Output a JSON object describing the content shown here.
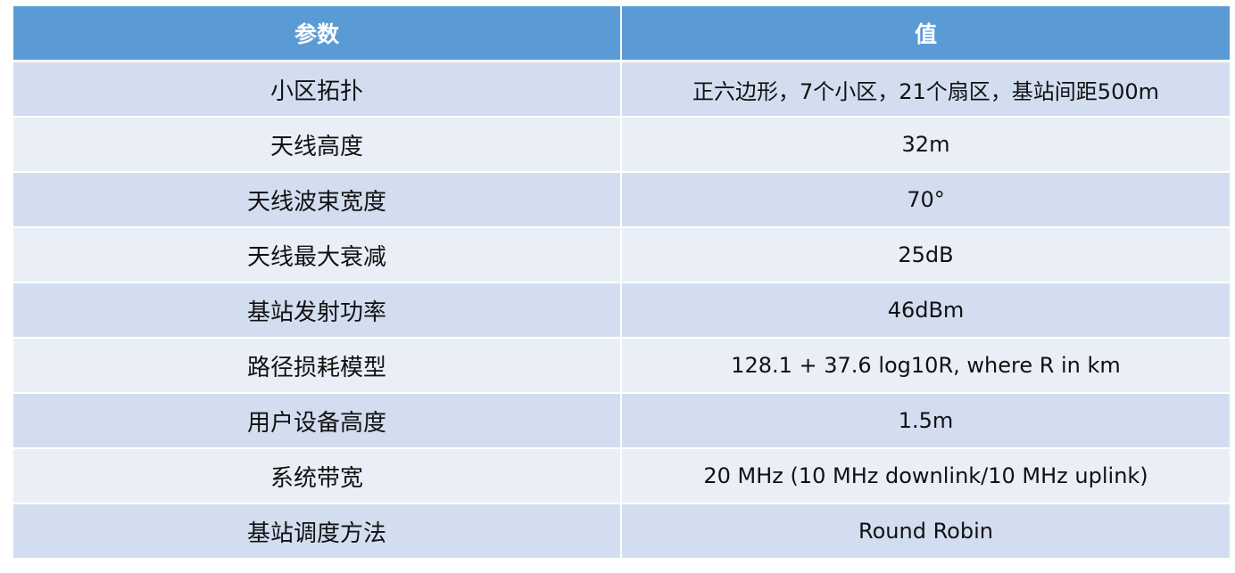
{
  "table": {
    "headers": [
      "参数",
      "值"
    ],
    "rows": [
      {
        "param": "小区拓扑",
        "value": "正六边形，7个小区，21个扇区，基站间距500m"
      },
      {
        "param": "天线高度",
        "value": "32m"
      },
      {
        "param": "天线波束宽度",
        "value": "70°"
      },
      {
        "param": "天线最大衰减",
        "value": "25dB"
      },
      {
        "param": "基站发射功率",
        "value": "46dBm"
      },
      {
        "param": "路径损耗模型",
        "value": "128.1 + 37.6 log10R, where R in km"
      },
      {
        "param": "用户设备高度",
        "value": "1.5m"
      },
      {
        "param": "系统带宽",
        "value": "20 MHz (10 MHz downlink/10 MHz uplink)"
      },
      {
        "param": "基站调度方法",
        "value": "Round Robin"
      }
    ]
  },
  "colors": {
    "header_bg": "#5b9bd5",
    "row_odd_bg": "#d2def0",
    "row_even_bg": "#eaeff7",
    "header_text": "#ffffff"
  }
}
